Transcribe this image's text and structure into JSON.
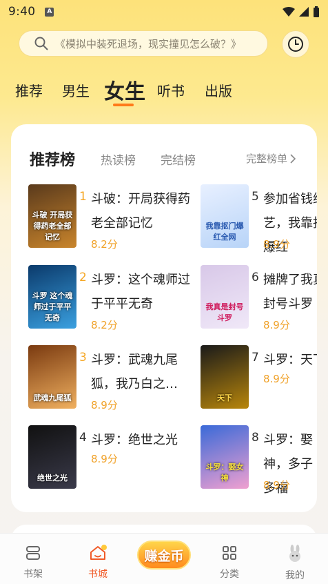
{
  "status_bar": {
    "time": "9:40",
    "notif_icon": "A"
  },
  "search": {
    "placeholder": "《模拟中装死退场，现实撞见怎么破？》"
  },
  "tabs": [
    {
      "label": "推荐"
    },
    {
      "label": "男生"
    },
    {
      "label": "女生",
      "active": true
    },
    {
      "label": "听书"
    },
    {
      "label": "出版"
    }
  ],
  "ranking": {
    "tabs": [
      {
        "label": "推荐榜",
        "active": true
      },
      {
        "label": "热读榜"
      },
      {
        "label": "完结榜"
      }
    ],
    "full_list_label": "完整榜单",
    "books": [
      {
        "rank": "1",
        "title": "斗破：开局获得药老全部记忆",
        "score": "8.2分",
        "cover_text": "斗破 开局获得药老全部记忆",
        "cover_colors": [
          "#5a3a1c",
          "#c9852c"
        ]
      },
      {
        "rank": "2",
        "title": "斗罗：这个魂师过于平平无奇",
        "score": "8.2分",
        "cover_text": "斗罗 这个魂师过于平平无奇",
        "cover_colors": [
          "#0b3a6b",
          "#3aa0e0"
        ]
      },
      {
        "rank": "3",
        "title": "斗罗：武魂九尾狐，我乃白之…",
        "score": "8.9分",
        "cover_text": "武魂九尾狐",
        "cover_colors": [
          "#7a3a10",
          "#f0b060"
        ]
      },
      {
        "rank": "4",
        "title": "斗罗：绝世之光",
        "score": "8.9分",
        "cover_text": "绝世之光",
        "cover_colors": [
          "#111111",
          "#3a3a4a"
        ]
      },
      {
        "rank": "5",
        "title": "参加省钱综艺，我靠抠门爆红",
        "score": "8.9分",
        "cover_text": "我靠抠门爆红全网",
        "cover_colors": [
          "#e8f0ff",
          "#b8d4f8"
        ]
      },
      {
        "rank": "6",
        "title": "摊牌了我真是封号斗罗",
        "score": "8.9分",
        "cover_text": "我真是封号斗罗",
        "cover_colors": [
          "#d8c8e8",
          "#f0e8f8"
        ]
      },
      {
        "rank": "7",
        "title": "斗罗：天下",
        "score": "8.9分",
        "cover_text": "天下",
        "cover_colors": [
          "#1a1a1a",
          "#b8860b"
        ]
      },
      {
        "rank": "8",
        "title": "斗罗：娶神，多子多福",
        "score": "8.9分",
        "cover_text": "斗罗：娶女神",
        "cover_colors": [
          "#3a6ad8",
          "#f0a0d0"
        ]
      }
    ]
  },
  "bottom_nav": {
    "items": [
      {
        "label": "书架",
        "icon": "bookshelf-icon"
      },
      {
        "label": "书城",
        "icon": "home-icon",
        "active": true
      },
      {
        "label": "分类",
        "icon": "grid-icon"
      },
      {
        "label": "我的",
        "icon": "rabbit-avatar-icon"
      }
    ],
    "earn_label": "赚金币"
  },
  "colors": {
    "accent": "#ff7a1a",
    "score": "#f0a22a",
    "active_nav": "#f05a28"
  }
}
